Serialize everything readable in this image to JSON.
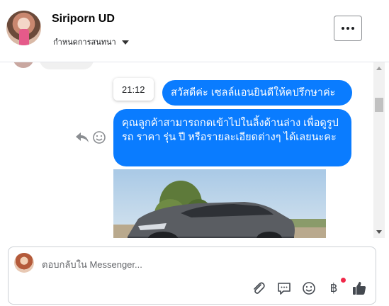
{
  "header": {
    "name": "Siriporn UD",
    "subtitle": "กำหนดการสนทนา",
    "more_label": "More options"
  },
  "messages": {
    "time_tooltip": "21:12",
    "bubble_1": "สวัสดีค่ะ เซลล์แอนยินดีให้คปรึกษาค่ะ",
    "bubble_2": "คุณลูกค้าสามารถกดเข้าไปในลิ้งด้านล่าง เพื่อดูรูปรถ ราคา รุ่น ปี หรือรายละเอียดต่างๆ ได้เลยนะคะ"
  },
  "composer": {
    "placeholder": "ตอบกลับใน Messenger...",
    "baht_symbol": "฿"
  },
  "colors": {
    "accent_blue": "#0a7cff",
    "notification_red": "#f02849"
  },
  "icons": [
    "reply-icon",
    "emoji-icon",
    "paperclip-icon",
    "chat-bubble-icon",
    "smiley-icon",
    "baht-icon",
    "thumbs-up-icon",
    "more-dots-icon",
    "dropdown-caret-icon"
  ]
}
